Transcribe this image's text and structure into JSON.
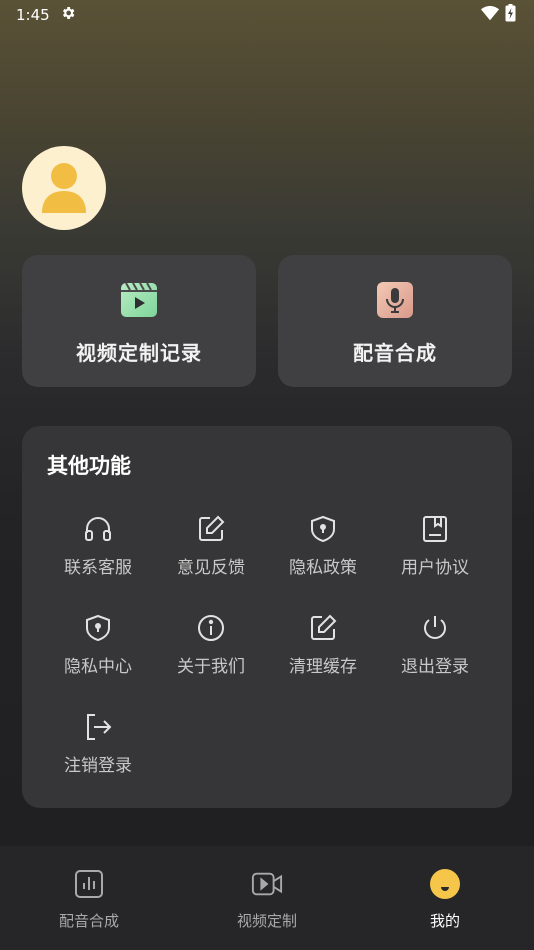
{
  "status_bar": {
    "time": "1:45"
  },
  "profile": {
    "avatar_icon": "user-icon"
  },
  "quick_cards": [
    {
      "label": "视频定制记录",
      "icon": "video-clapper-icon"
    },
    {
      "label": "配音合成",
      "icon": "microphone-icon"
    }
  ],
  "other_features": {
    "title": "其他功能",
    "items": [
      {
        "label": "联系客服",
        "icon": "headset-icon"
      },
      {
        "label": "意见反馈",
        "icon": "edit-icon"
      },
      {
        "label": "隐私政策",
        "icon": "shield-lock-icon"
      },
      {
        "label": "用户协议",
        "icon": "bookmark-book-icon"
      },
      {
        "label": "隐私中心",
        "icon": "shield-lock-icon"
      },
      {
        "label": "关于我们",
        "icon": "info-icon"
      },
      {
        "label": "清理缓存",
        "icon": "edit-icon"
      },
      {
        "label": "退出登录",
        "icon": "power-icon"
      },
      {
        "label": "注销登录",
        "icon": "logout-icon"
      }
    ]
  },
  "bottom_nav": [
    {
      "label": "配音合成",
      "icon": "audio-bars-icon",
      "active": false
    },
    {
      "label": "视频定制",
      "icon": "video-camera-icon",
      "active": false
    },
    {
      "label": "我的",
      "icon": "smile-profile-icon",
      "active": true
    }
  ],
  "colors": {
    "accent": "#f5c64a",
    "card_bg": "#404042",
    "panel_bg": "#363638"
  }
}
